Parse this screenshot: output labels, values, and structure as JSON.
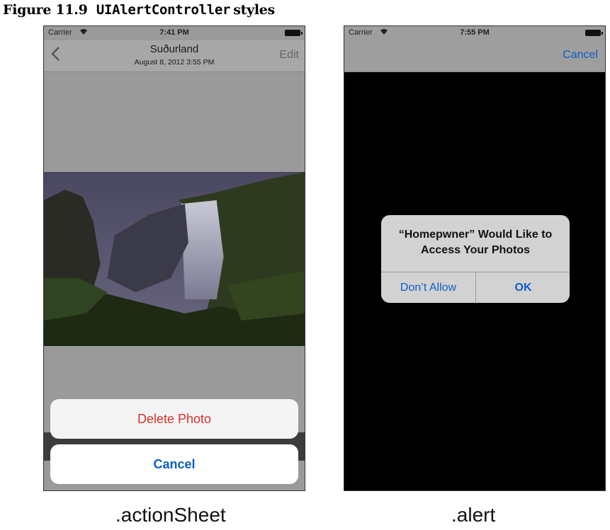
{
  "figure": {
    "label": "Figure 11.9",
    "class_name": "UIAlertController",
    "suffix": "styles"
  },
  "left_phone": {
    "status": {
      "carrier": "Carrier",
      "time": "7:41 PM"
    },
    "nav": {
      "title": "Suðurland",
      "subtitle": "August 8, 2012  3:55 PM",
      "edit": "Edit"
    },
    "action_sheet": {
      "destructive": "Delete Photo",
      "cancel": "Cancel"
    },
    "caption": ".actionSheet"
  },
  "right_phone": {
    "status": {
      "carrier": "Carrier",
      "time": "7:55 PM"
    },
    "nav": {
      "cancel": "Cancel"
    },
    "alert": {
      "line1": "“Homepwner” Would Like to",
      "line2": "Access Your Photos",
      "dont_allow": "Don’t Allow",
      "ok": "OK"
    },
    "caption": ".alert"
  },
  "icons": [
    "wifi-icon",
    "battery-icon",
    "back-chevron-icon"
  ],
  "colors": {
    "ios_blue": "#0a5ec9",
    "destructive_red": "#d9322b"
  }
}
